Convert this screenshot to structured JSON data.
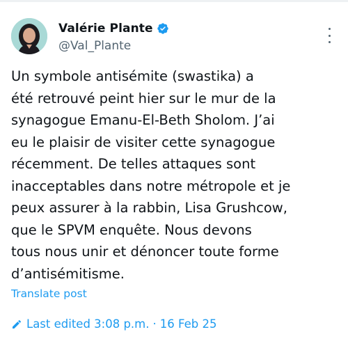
{
  "tweet": {
    "author": {
      "display_name": "Valérie Plante",
      "handle": "@Val_Plante",
      "verified": true
    },
    "text": "Un symbole antisémite (swastika) a\nété retrouvé peint hier sur le mur de la\nsynagogue Emanu-El-Beth Sholom. J’ai\neu le plaisir de visiter cette synagogue\nrécemment. De telles attaques sont\ninacceptables dans notre métropole et je\npeux assurer à la rabbin, Lisa Grushcow,\nque le SPVM enquête. Nous devons\ntous nous unir et dénoncer toute forme\nd’antisémitisme.",
    "translate_label": "Translate post",
    "edited": {
      "label": "Last edited 3:08 p.m.",
      "separator": "·",
      "date": "16 Feb 25"
    }
  },
  "icons": {
    "verified": "verified-badge-icon",
    "more": "more-options-icon",
    "edit": "pencil-icon"
  },
  "colors": {
    "accent": "#1d9bf0",
    "text": "#0f1419",
    "secondary": "#536471"
  }
}
